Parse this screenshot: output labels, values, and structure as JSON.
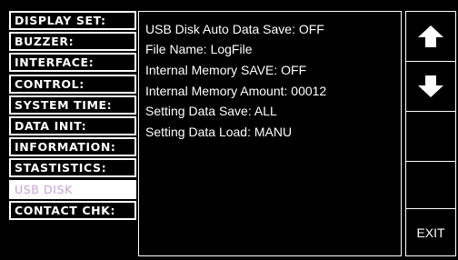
{
  "menu": {
    "items": [
      {
        "label": "DISPLAY SET:",
        "selected": false
      },
      {
        "label": "BUZZER:",
        "selected": false
      },
      {
        "label": "INTERFACE:",
        "selected": false
      },
      {
        "label": "CONTROL:",
        "selected": false
      },
      {
        "label": "SYSTEM TIME:",
        "selected": false
      },
      {
        "label": "DATA INIT:",
        "selected": false
      },
      {
        "label": "INFORMATION:",
        "selected": false
      },
      {
        "label": "STASTISTICS:",
        "selected": false
      },
      {
        "label": "USB DISK",
        "selected": true
      },
      {
        "label": "CONTACT CHK:",
        "selected": false
      }
    ]
  },
  "info": {
    "lines": [
      "USB Disk Auto Data Save: OFF",
      "File Name: LogFile",
      "Internal Memory SAVE: OFF",
      "Internal Memory Amount: 00012",
      "Setting Data Save: ALL",
      "Setting Data Load: MANU"
    ]
  },
  "softkeys": {
    "up_icon": "arrow-up-icon",
    "down_icon": "arrow-down-icon",
    "exit_label": "EXIT"
  },
  "colors": {
    "background": "#000000",
    "border": "#ffffff",
    "text": "#ffffff",
    "selected_bg": "#ffffff",
    "selected_text": "#c8a0d4"
  }
}
